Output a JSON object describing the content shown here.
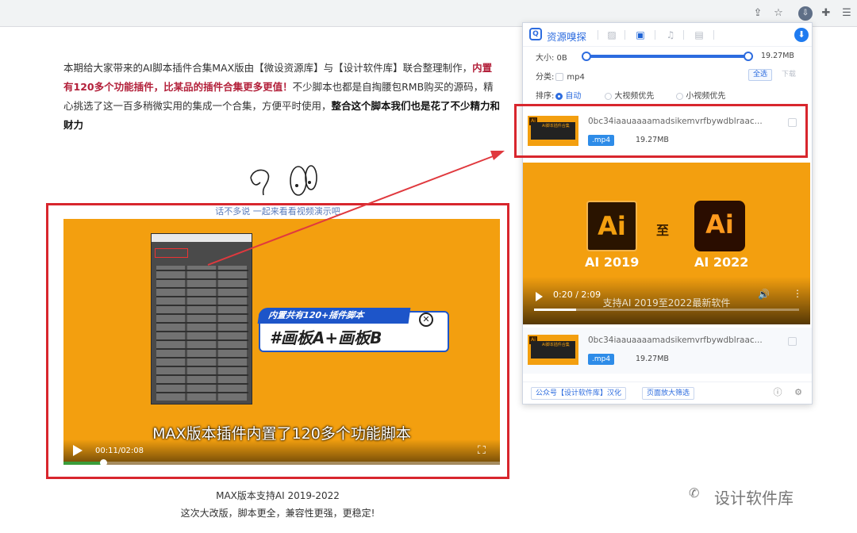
{
  "browser": {
    "icons": [
      "share-icon",
      "star-icon",
      "extension-active-icon",
      "puzzle-icon",
      "reading-list-icon"
    ]
  },
  "article": {
    "p1": "本期给大家带来的AI脚本插件合集MAX版由【微设资源库】与【设计软件库】联合整理制作，",
    "p1_red": "内置有120多个功能插件，比某品的插件合集更多更值！",
    "p2": "不少脚本也都是自掏腰包RMB购买的源码，精心挑选了这一百多稍微实用的集成一个合集，方便平时使用，",
    "p2_bold": "整合这个脚本我们也是花了不少精力和财力"
  },
  "hint": "话不多说   一起来看看视频演示吧",
  "video": {
    "banner_small": "内置共有120+插件脚本",
    "banner_main": "#画板A+画板B",
    "subtitle": "MAX版本插件内置了120多个功能脚本",
    "time": "00:11/02:08",
    "progress": 0.09
  },
  "caption": {
    "line1": "MAX版本支持AI 2019-2022",
    "line2": "这次大改版，脚本更全，兼容性更强，更稳定!"
  },
  "watermark": "设计软件库",
  "popup": {
    "title": "资源嗅探",
    "size_label": "大小: 0B",
    "size_max": "19.27MB",
    "type_label": "分类:",
    "type_value": "mp4",
    "select_all": "全选",
    "download": "下载",
    "sort_label": "排序:",
    "sort_options": [
      "自动",
      "大视频优先",
      "小视频优先"
    ],
    "items": [
      {
        "name": "0bc34iaauaaaamadsikemvrfbywdblraac...",
        "ext": ".mp4",
        "size": "19.27MB"
      },
      {
        "name": "0bc34iaauaaaamadsikemvrfbywdblraac...",
        "ext": ".mp4",
        "size": "19.27MB"
      }
    ],
    "preview": {
      "logo_a": "Ai",
      "logo_b": "Ai",
      "to": "至",
      "label_a": "AI 2019",
      "label_b": "AI 2022",
      "time": "0:20 / 2:09",
      "sub": "支持AI 2019至2022最新软件",
      "progress": 0.16
    },
    "footer_link1": "公众号【设计软件库】汉化",
    "footer_link2": "页面放大筛选"
  }
}
